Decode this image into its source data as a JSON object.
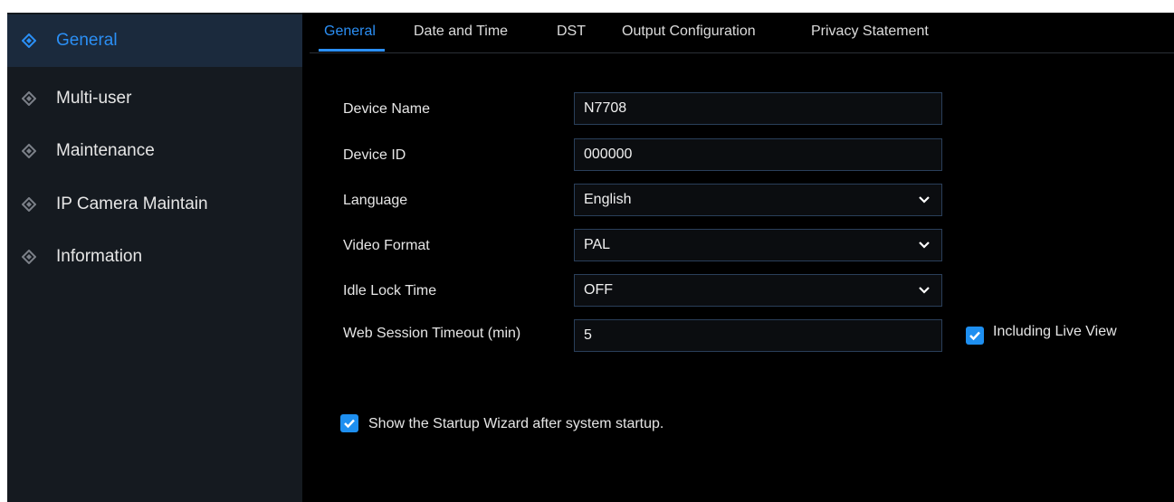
{
  "sidebar": {
    "items": [
      {
        "label": "General",
        "icon": "diamond-compass-icon",
        "active": true
      },
      {
        "label": "Multi-user",
        "icon": "diamond-compass-icon"
      },
      {
        "label": "Maintenance",
        "icon": "diamond-compass-icon"
      },
      {
        "label": "IP Camera Maintain",
        "icon": "diamond-compass-icon"
      },
      {
        "label": "Information",
        "icon": "diamond-compass-icon"
      }
    ]
  },
  "tabs": [
    {
      "label": "General",
      "active": true
    },
    {
      "label": "Date and Time"
    },
    {
      "label": "DST"
    },
    {
      "label": "Output Configuration"
    },
    {
      "label": "Privacy Statement"
    }
  ],
  "form": {
    "device_name": {
      "label": "Device Name",
      "value": "N7708"
    },
    "device_id": {
      "label": "Device ID",
      "value": "000000"
    },
    "language": {
      "label": "Language",
      "value": "English"
    },
    "video_format": {
      "label": "Video Format",
      "value": "PAL"
    },
    "idle_lock_time": {
      "label": "Idle Lock Time",
      "value": "OFF"
    },
    "web_session_timeout": {
      "label": "Web Session Timeout (min)",
      "value": "5"
    }
  },
  "checkboxes": {
    "including_live_view": {
      "label": "Including Live View",
      "checked": true
    },
    "startup_wizard": {
      "label": "Show the Startup Wizard after system startup.",
      "checked": true
    }
  },
  "colors": {
    "accent": "#2b8ff5",
    "sidebar_bg": "#151a20",
    "active_item_bg": "#1b2a3d",
    "field_border": "#2a3f5a"
  }
}
